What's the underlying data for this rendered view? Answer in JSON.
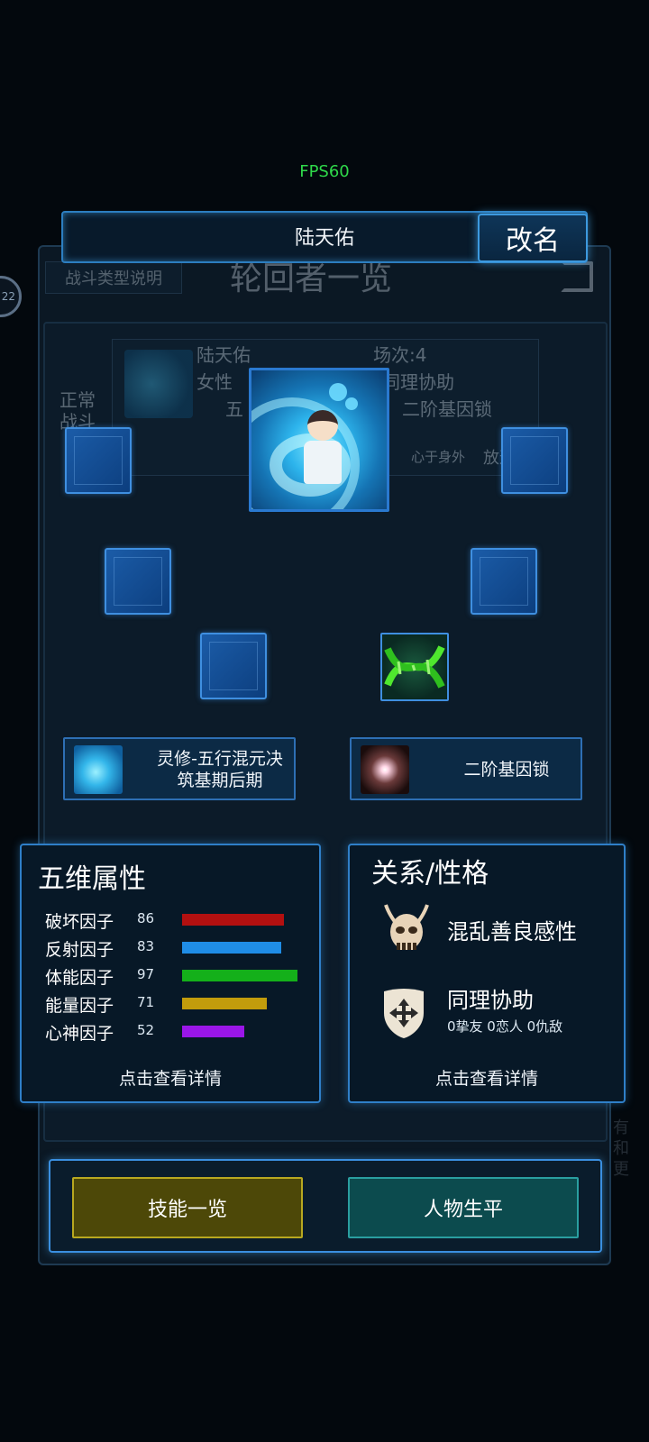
{
  "fps": "FPS60",
  "edge_badge": "22",
  "edge_text": "有和更",
  "underlying": {
    "tab_label": "战斗类型说明",
    "title": "轮回者一览",
    "status": "正常战斗",
    "name": "陆天佑",
    "gender": "女性",
    "session": "场次:4",
    "trait": "同理协助",
    "element": "五",
    "gene": "二阶基因锁",
    "mind": "心于身外",
    "release": "放逐"
  },
  "character": {
    "name": "陆天佑",
    "rename_label": "改名"
  },
  "skills": [
    {
      "icon": "spirit-swirl-icon",
      "line1": "灵修-五行混元决",
      "line2": "筑基期后期"
    },
    {
      "icon": "star-burst-icon",
      "line1": "二阶基因锁"
    }
  ],
  "attributes": {
    "title": "五维属性",
    "detail_label": "点击查看详情",
    "stats": [
      {
        "name": "破坏因子",
        "value": 86,
        "color": "#b31010"
      },
      {
        "name": "反射因子",
        "value": 83,
        "color": "#1f8de6"
      },
      {
        "name": "体能因子",
        "value": 97,
        "color": "#14b01a"
      },
      {
        "name": "能量因子",
        "value": 71,
        "color": "#c29c0c"
      },
      {
        "name": "心神因子",
        "value": 52,
        "color": "#9a16e8"
      }
    ]
  },
  "relations": {
    "title": "关系/性格",
    "personality": "混乱善良感性",
    "trait": "同理协助",
    "social": "0挚友 0恋人 0仇敌",
    "detail_label": "点击查看详情"
  },
  "buttons": {
    "skills": "技能一览",
    "life": "人物生平"
  }
}
